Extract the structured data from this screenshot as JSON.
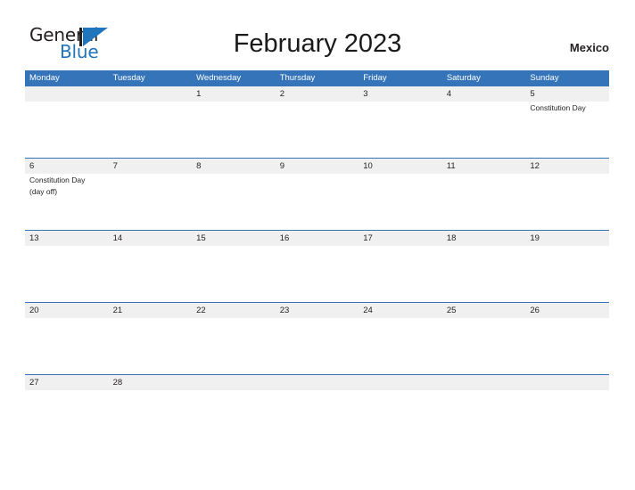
{
  "brand": {
    "name_part1": "General",
    "name_part2": "Blue",
    "logo_icon": "blue-triangle-flag-icon"
  },
  "header": {
    "title": "February 2023",
    "region": "Mexico"
  },
  "calendar": {
    "weekday_headers": [
      "Monday",
      "Tuesday",
      "Wednesday",
      "Thursday",
      "Friday",
      "Saturday",
      "Sunday"
    ],
    "accent_color": "#3574b8",
    "band_color": "#f0f0f0",
    "weeks": [
      {
        "days": [
          {
            "number": "",
            "events": []
          },
          {
            "number": "",
            "events": []
          },
          {
            "number": "1",
            "events": []
          },
          {
            "number": "2",
            "events": []
          },
          {
            "number": "3",
            "events": []
          },
          {
            "number": "4",
            "events": []
          },
          {
            "number": "5",
            "events": [
              "Constitution Day"
            ]
          }
        ]
      },
      {
        "days": [
          {
            "number": "6",
            "events": [
              "Constitution Day",
              "(day off)"
            ]
          },
          {
            "number": "7",
            "events": []
          },
          {
            "number": "8",
            "events": []
          },
          {
            "number": "9",
            "events": []
          },
          {
            "number": "10",
            "events": []
          },
          {
            "number": "11",
            "events": []
          },
          {
            "number": "12",
            "events": []
          }
        ]
      },
      {
        "days": [
          {
            "number": "13",
            "events": []
          },
          {
            "number": "14",
            "events": []
          },
          {
            "number": "15",
            "events": []
          },
          {
            "number": "16",
            "events": []
          },
          {
            "number": "17",
            "events": []
          },
          {
            "number": "18",
            "events": []
          },
          {
            "number": "19",
            "events": []
          }
        ]
      },
      {
        "days": [
          {
            "number": "20",
            "events": []
          },
          {
            "number": "21",
            "events": []
          },
          {
            "number": "22",
            "events": []
          },
          {
            "number": "23",
            "events": []
          },
          {
            "number": "24",
            "events": []
          },
          {
            "number": "25",
            "events": []
          },
          {
            "number": "26",
            "events": []
          }
        ]
      },
      {
        "days": [
          {
            "number": "27",
            "events": []
          },
          {
            "number": "28",
            "events": []
          },
          {
            "number": "",
            "events": []
          },
          {
            "number": "",
            "events": []
          },
          {
            "number": "",
            "events": []
          },
          {
            "number": "",
            "events": []
          },
          {
            "number": "",
            "events": []
          }
        ]
      }
    ]
  }
}
